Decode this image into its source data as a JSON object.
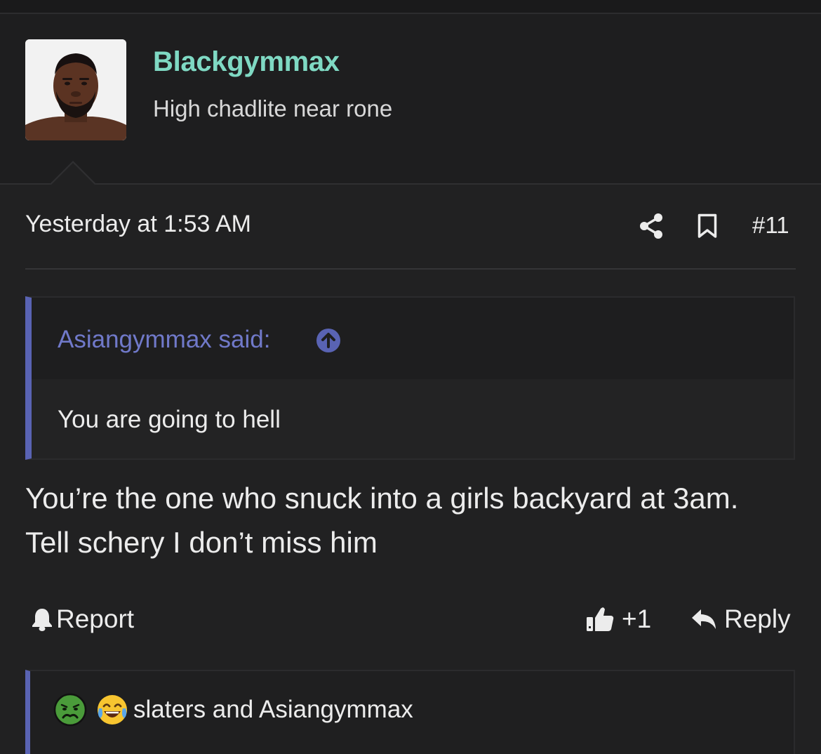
{
  "user": {
    "name": "Blackgymmax",
    "title": "High chadlite near rone",
    "name_color": "#7fd9c3"
  },
  "meta": {
    "date": "Yesterday at 1:53 AM",
    "post_number": "#11"
  },
  "quote": {
    "author_label": "Asiangymmax said:",
    "text": "You are going to hell",
    "accent": "#5963b3"
  },
  "body": {
    "text": "You’re the one who snuck into a girls backyard at 3am. Tell schery I don’t miss him"
  },
  "actions": {
    "report_label": "Report",
    "like_count": "+1",
    "reply_label": "Reply"
  },
  "reactions": {
    "icons": [
      "sick-face-emoji",
      "tears-of-joy-emoji"
    ],
    "text": "slaters and Asiangymmax"
  }
}
